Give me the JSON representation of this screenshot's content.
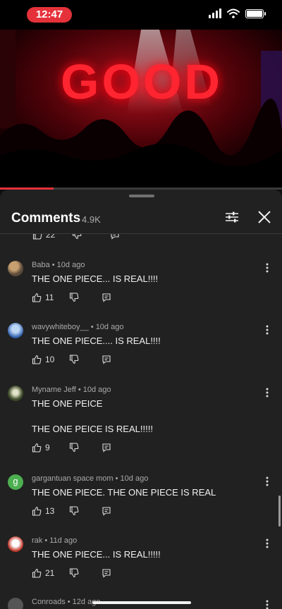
{
  "status_bar": {
    "time": "12:47"
  },
  "video": {
    "sign_text": "GOOD",
    "progress_percent": 19
  },
  "comments_panel": {
    "title": "Comments",
    "count": "4.9K",
    "top_partial": {
      "likes": "22"
    },
    "items": [
      {
        "author": "Baba",
        "age": "10d ago",
        "lines": [
          "THE ONE PIECE... IS REAL!!!!"
        ],
        "likes": "11"
      },
      {
        "author": "wavywhiteboy__",
        "age": "10d ago",
        "lines": [
          "THE ONE PIECE.... IS REAL!!!!"
        ],
        "likes": "10"
      },
      {
        "author": "Myname Jeff",
        "age": "10d ago",
        "lines": [
          "THE ONE PEICE",
          "",
          "THE ONE PEICE IS REAL!!!!!"
        ],
        "likes": "9"
      },
      {
        "author": "gargantuan space mom",
        "age": "10d ago",
        "lines": [
          "THE ONE PIECE. THE ONE PIECE IS REAL"
        ],
        "likes": "13"
      },
      {
        "author": "rak",
        "age": "11d ago",
        "lines": [
          "THE ONE PIECE... IS REAL!!!!!"
        ],
        "likes": "21"
      },
      {
        "author": "Conroads",
        "age": "12d ago",
        "lines": [],
        "likes": ""
      }
    ]
  },
  "colors": {
    "accent": "#e5323a",
    "background": "#0f0f0f",
    "sheet": "#212121"
  }
}
